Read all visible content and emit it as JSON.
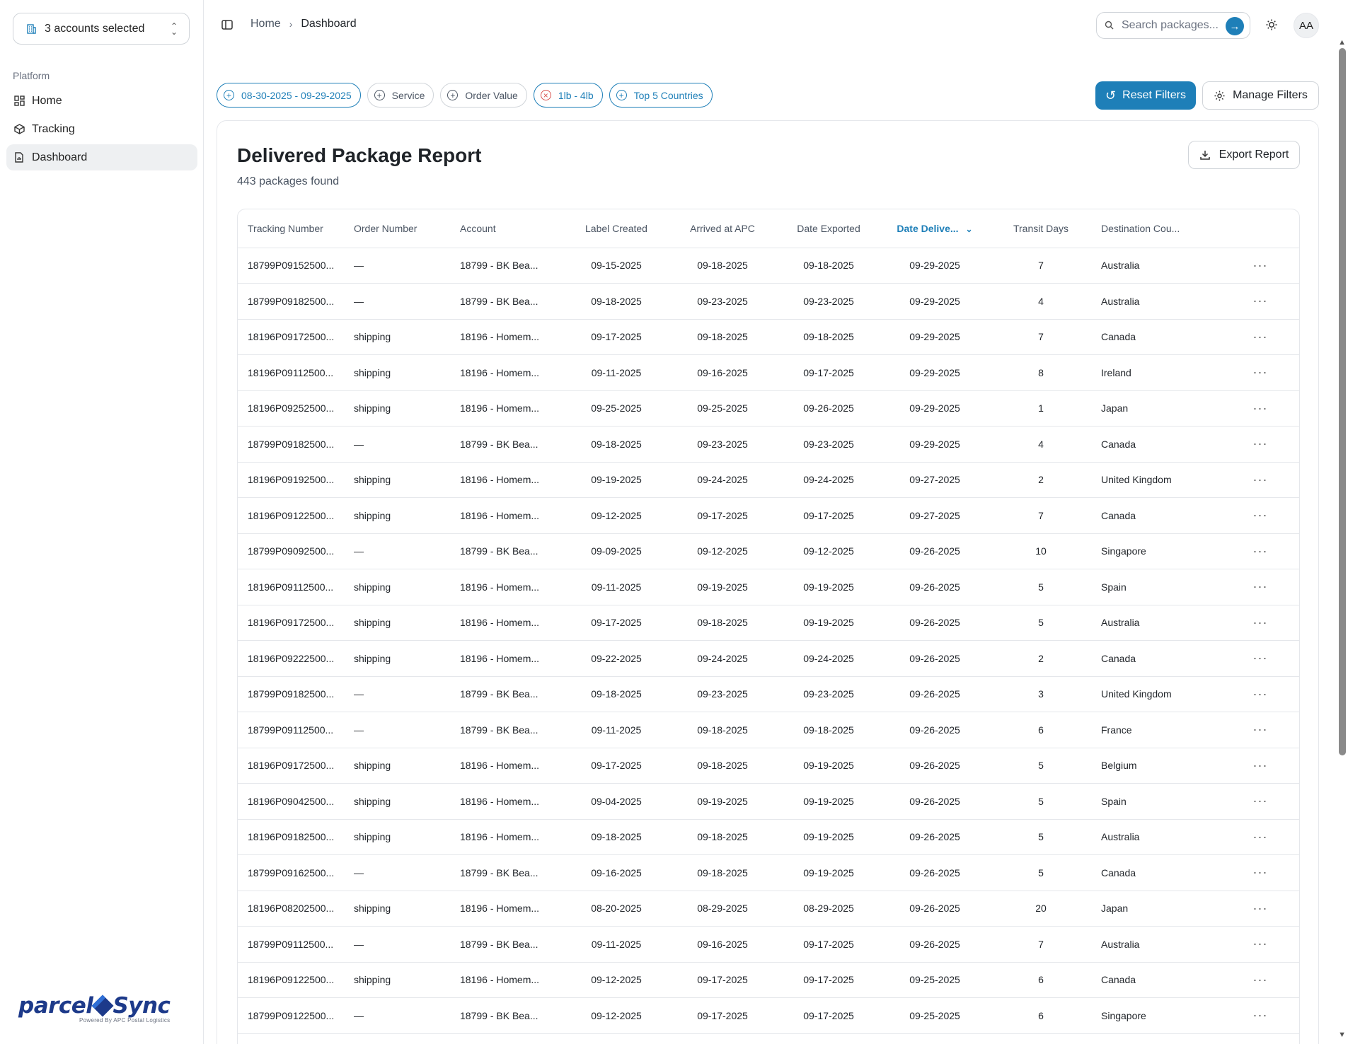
{
  "account_selector": {
    "label": "3 accounts selected"
  },
  "sidebar": {
    "section_label": "Platform",
    "items": [
      {
        "label": "Home",
        "icon": "grid-icon"
      },
      {
        "label": "Tracking",
        "icon": "package-icon"
      },
      {
        "label": "Dashboard",
        "icon": "report-icon",
        "active": true
      }
    ]
  },
  "brand": {
    "name_left": "parcel",
    "name_right": "Sync",
    "tagline": "Powered By APC Postal Logistics"
  },
  "breadcrumb": {
    "home": "Home",
    "current": "Dashboard"
  },
  "search": {
    "placeholder": "Search packages..."
  },
  "avatar": {
    "initials": "AA"
  },
  "filters": [
    {
      "label": "08-30-2025 - 09-29-2025",
      "active": true,
      "icon": "plus-circle-icon"
    },
    {
      "label": "Service",
      "active": false,
      "icon": "plus-circle-icon"
    },
    {
      "label": "Order Value",
      "active": false,
      "icon": "plus-circle-icon"
    },
    {
      "label": "1lb - 4lb",
      "active": true,
      "icon": "x-circle-icon"
    },
    {
      "label": "Top 5 Countries",
      "active": true,
      "icon": "plus-circle-icon"
    }
  ],
  "buttons": {
    "reset_filters": "Reset Filters",
    "manage_filters": "Manage Filters",
    "export_report": "Export Report"
  },
  "report": {
    "title": "Delivered Package Report",
    "subtitle": "443 packages found",
    "columns": [
      "Tracking Number",
      "Order Number",
      "Account",
      "Label Created",
      "Arrived at APC",
      "Date Exported",
      "Date Delive...",
      "Transit Days",
      "Destination Cou..."
    ],
    "rows": [
      [
        "18799P09152500...",
        "—",
        "18799 - BK Bea...",
        "09-15-2025",
        "09-18-2025",
        "09-18-2025",
        "09-29-2025",
        "7",
        "Australia"
      ],
      [
        "18799P09182500...",
        "—",
        "18799 - BK Bea...",
        "09-18-2025",
        "09-23-2025",
        "09-23-2025",
        "09-29-2025",
        "4",
        "Australia"
      ],
      [
        "18196P09172500...",
        "shipping",
        "18196 - Homem...",
        "09-17-2025",
        "09-18-2025",
        "09-18-2025",
        "09-29-2025",
        "7",
        "Canada"
      ],
      [
        "18196P09112500...",
        "shipping",
        "18196 - Homem...",
        "09-11-2025",
        "09-16-2025",
        "09-17-2025",
        "09-29-2025",
        "8",
        "Ireland"
      ],
      [
        "18196P09252500...",
        "shipping",
        "18196 - Homem...",
        "09-25-2025",
        "09-25-2025",
        "09-26-2025",
        "09-29-2025",
        "1",
        "Japan"
      ],
      [
        "18799P09182500...",
        "—",
        "18799 - BK Bea...",
        "09-18-2025",
        "09-23-2025",
        "09-23-2025",
        "09-29-2025",
        "4",
        "Canada"
      ],
      [
        "18196P09192500...",
        "shipping",
        "18196 - Homem...",
        "09-19-2025",
        "09-24-2025",
        "09-24-2025",
        "09-27-2025",
        "2",
        "United Kingdom"
      ],
      [
        "18196P09122500...",
        "shipping",
        "18196 - Homem...",
        "09-12-2025",
        "09-17-2025",
        "09-17-2025",
        "09-27-2025",
        "7",
        "Canada"
      ],
      [
        "18799P09092500...",
        "—",
        "18799 - BK Bea...",
        "09-09-2025",
        "09-12-2025",
        "09-12-2025",
        "09-26-2025",
        "10",
        "Singapore"
      ],
      [
        "18196P09112500...",
        "shipping",
        "18196 - Homem...",
        "09-11-2025",
        "09-19-2025",
        "09-19-2025",
        "09-26-2025",
        "5",
        "Spain"
      ],
      [
        "18196P09172500...",
        "shipping",
        "18196 - Homem...",
        "09-17-2025",
        "09-18-2025",
        "09-19-2025",
        "09-26-2025",
        "5",
        "Australia"
      ],
      [
        "18196P09222500...",
        "shipping",
        "18196 - Homem...",
        "09-22-2025",
        "09-24-2025",
        "09-24-2025",
        "09-26-2025",
        "2",
        "Canada"
      ],
      [
        "18799P09182500...",
        "—",
        "18799 - BK Bea...",
        "09-18-2025",
        "09-23-2025",
        "09-23-2025",
        "09-26-2025",
        "3",
        "United Kingdom"
      ],
      [
        "18799P09112500...",
        "—",
        "18799 - BK Bea...",
        "09-11-2025",
        "09-18-2025",
        "09-18-2025",
        "09-26-2025",
        "6",
        "France"
      ],
      [
        "18196P09172500...",
        "shipping",
        "18196 - Homem...",
        "09-17-2025",
        "09-18-2025",
        "09-19-2025",
        "09-26-2025",
        "5",
        "Belgium"
      ],
      [
        "18196P09042500...",
        "shipping",
        "18196 - Homem...",
        "09-04-2025",
        "09-19-2025",
        "09-19-2025",
        "09-26-2025",
        "5",
        "Spain"
      ],
      [
        "18196P09182500...",
        "shipping",
        "18196 - Homem...",
        "09-18-2025",
        "09-18-2025",
        "09-19-2025",
        "09-26-2025",
        "5",
        "Australia"
      ],
      [
        "18799P09162500...",
        "—",
        "18799 - BK Bea...",
        "09-16-2025",
        "09-18-2025",
        "09-19-2025",
        "09-26-2025",
        "5",
        "Canada"
      ],
      [
        "18196P08202500...",
        "shipping",
        "18196 - Homem...",
        "08-20-2025",
        "08-29-2025",
        "08-29-2025",
        "09-26-2025",
        "20",
        "Japan"
      ],
      [
        "18799P09112500...",
        "—",
        "18799 - BK Bea...",
        "09-11-2025",
        "09-16-2025",
        "09-17-2025",
        "09-26-2025",
        "7",
        "Australia"
      ],
      [
        "18196P09122500...",
        "shipping",
        "18196 - Homem...",
        "09-12-2025",
        "09-17-2025",
        "09-17-2025",
        "09-25-2025",
        "6",
        "Canada"
      ],
      [
        "18799P09122500...",
        "—",
        "18799 - BK Bea...",
        "09-12-2025",
        "09-17-2025",
        "09-17-2025",
        "09-25-2025",
        "6",
        "Singapore"
      ]
    ]
  },
  "colors": {
    "accent": "#1e7fb8",
    "danger": "#d9534f",
    "border": "#e5e7eb"
  }
}
